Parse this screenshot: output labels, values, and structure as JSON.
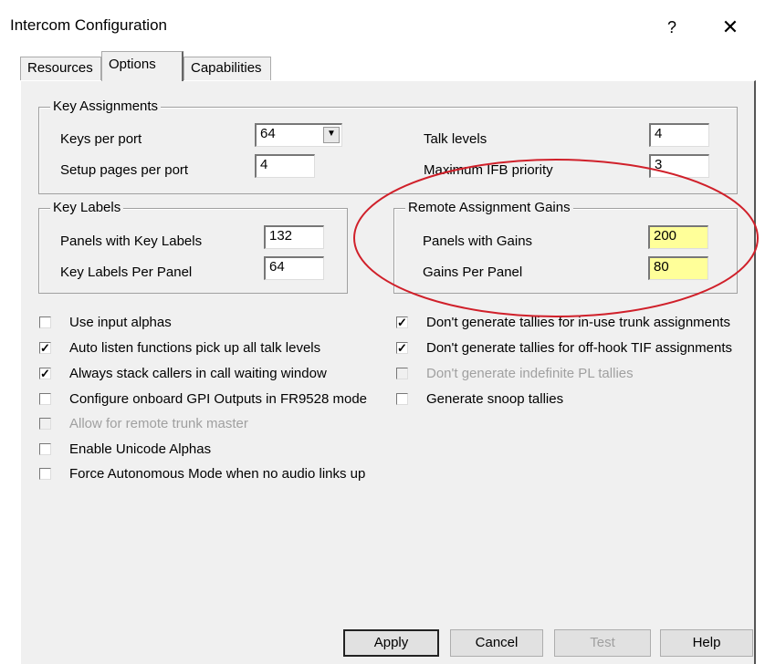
{
  "window": {
    "title": "Intercom Configuration",
    "help_glyph": "?",
    "close_glyph": "✕"
  },
  "tabs": [
    {
      "label": "Resources"
    },
    {
      "label": "Options"
    },
    {
      "label": "Capabilities"
    }
  ],
  "key_assignments": {
    "legend": "Key Assignments",
    "keys_per_port_label": "Keys per port",
    "keys_per_port_value": "64",
    "setup_pages_label": "Setup pages per port",
    "setup_pages_value": "4",
    "talk_levels_label": "Talk levels",
    "talk_levels_value": "4",
    "max_ifb_label": "Maximum IFB priority",
    "max_ifb_value": "3"
  },
  "key_labels": {
    "legend": "Key Labels",
    "panels_label": "Panels with Key Labels",
    "panels_value": "132",
    "per_panel_label": "Key Labels Per Panel",
    "per_panel_value": "64"
  },
  "remote_gains": {
    "legend": "Remote Assignment Gains",
    "panels_label": "Panels with Gains",
    "panels_value": "200",
    "per_panel_label": "Gains Per Panel",
    "per_panel_value": "80",
    "highlight_color": "#ffff99",
    "annotation_color": "#d0202a"
  },
  "options_left": [
    {
      "label": "Use input alphas",
      "checked": false,
      "enabled": true
    },
    {
      "label": "Auto listen functions pick up all talk levels",
      "checked": true,
      "enabled": true
    },
    {
      "label": "Always stack callers in call waiting window",
      "checked": true,
      "enabled": true
    },
    {
      "label": "Configure onboard GPI Outputs in FR9528 mode",
      "checked": false,
      "enabled": true
    },
    {
      "label": "Allow for remote trunk master",
      "checked": false,
      "enabled": false
    },
    {
      "label": "Enable Unicode Alphas",
      "checked": false,
      "enabled": true
    },
    {
      "label": "Force Autonomous Mode when no audio links up",
      "checked": false,
      "enabled": true
    }
  ],
  "options_right": [
    {
      "label": "Don't generate tallies for in-use trunk assignments",
      "checked": true,
      "enabled": true
    },
    {
      "label": "Don't generate tallies for off-hook TIF assignments",
      "checked": true,
      "enabled": true
    },
    {
      "label": "Don't generate indefinite PL tallies",
      "checked": false,
      "enabled": false
    },
    {
      "label": "Generate snoop tallies",
      "checked": false,
      "enabled": true
    }
  ],
  "buttons": {
    "apply": "Apply",
    "cancel": "Cancel",
    "test": "Test",
    "help": "Help"
  }
}
